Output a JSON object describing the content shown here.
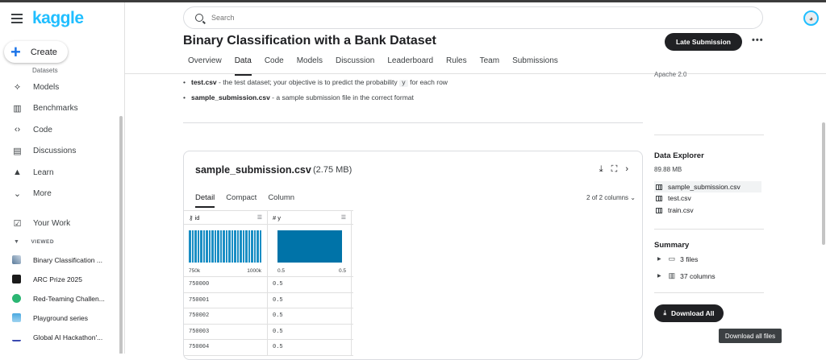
{
  "app": {
    "logo": "kaggle",
    "create_label": "Create"
  },
  "sidebar": {
    "cut_item": "Datasets",
    "items": [
      {
        "label": "Models",
        "icon": "models-icon"
      },
      {
        "label": "Benchmarks",
        "icon": "benchmarks-icon"
      },
      {
        "label": "Code",
        "icon": "code-icon"
      },
      {
        "label": "Discussions",
        "icon": "discussions-icon"
      },
      {
        "label": "Learn",
        "icon": "learn-icon"
      },
      {
        "label": "More",
        "icon": "chevron-down-icon"
      },
      {
        "label": "Your Work",
        "icon": "your-work-icon"
      }
    ],
    "viewed_header": "VIEWED",
    "viewed": [
      {
        "label": "Binary Classification ...",
        "color": "#5a7a9a"
      },
      {
        "label": "ARC Prize 2025",
        "color": "#1a1a1a"
      },
      {
        "label": "Red-Teaming Challen...",
        "color": "#2bb673"
      },
      {
        "label": "Playground series",
        "color": "#4aa8e0"
      },
      {
        "label": "Global AI Hackathon'...",
        "color": "#ffffff"
      }
    ]
  },
  "search": {
    "placeholder": "Search"
  },
  "header": {
    "title": "Binary Classification with a Bank Dataset",
    "late_submission": "Late Submission",
    "more": "•••",
    "tabs": [
      "Overview",
      "Data",
      "Code",
      "Models",
      "Discussion",
      "Leaderboard",
      "Rules",
      "Team",
      "Submissions"
    ],
    "active_tab": "Data"
  },
  "content": {
    "bullet1_name": "test.csv",
    "bullet1_text_a": " - the test dataset; your objective is to predict the probability ",
    "bullet1_code": "y",
    "bullet1_text_b": " for each row",
    "bullet2_name": "sample_submission.csv",
    "bullet2_text": " - a sample submission file in the correct format"
  },
  "file_card": {
    "name": "sample_submission.csv",
    "size": "(2.75 MB)",
    "tabs": [
      "Detail",
      "Compact",
      "Column"
    ],
    "columns_count": "2 of 2 columns",
    "col1": "id",
    "col2": "y",
    "id_min": "750k",
    "id_max": "1000k",
    "y_min": "0.5",
    "y_max": "0.5",
    "rows": [
      [
        "750000",
        "0.5"
      ],
      [
        "750001",
        "0.5"
      ],
      [
        "750002",
        "0.5"
      ],
      [
        "750003",
        "0.5"
      ],
      [
        "750004",
        "0.5"
      ]
    ]
  },
  "right_panel": {
    "license": "Apache 2.0",
    "explorer_title": "Data Explorer",
    "explorer_size": "89.88 MB",
    "files": [
      "sample_submission.csv",
      "test.csv",
      "train.csv"
    ],
    "summary_title": "Summary",
    "summary_files": "3 files",
    "summary_columns": "37 columns",
    "download_all": "Download All",
    "tooltip": "Download all files"
  }
}
